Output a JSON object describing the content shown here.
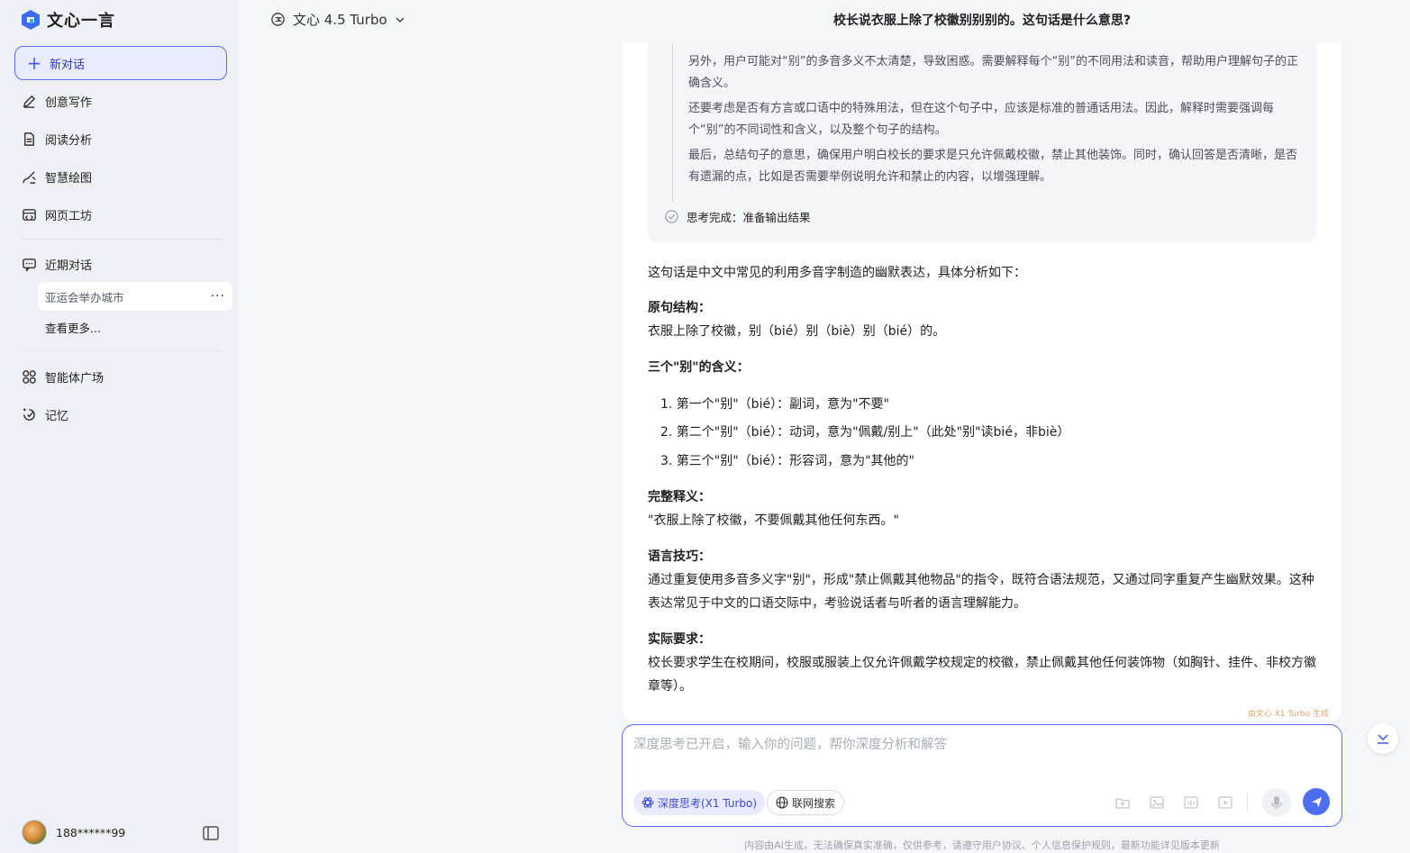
{
  "app": {
    "name": "文心一言",
    "accent": "#4e6ef2"
  },
  "sidebar": {
    "new_chat": "新对话",
    "items": [
      {
        "label": "创意写作",
        "icon": "pen-icon"
      },
      {
        "label": "阅读分析",
        "icon": "document-icon"
      },
      {
        "label": "智慧绘图",
        "icon": "brush-icon"
      },
      {
        "label": "网页工坊",
        "icon": "web-icon"
      }
    ],
    "recent_title": "近期对话",
    "recent": [
      {
        "label": "亚运会举办城市",
        "more": "···"
      }
    ],
    "more_link": "查看更多...",
    "bottom_items": [
      {
        "label": "智能体广场",
        "icon": "agents-icon"
      },
      {
        "label": "记忆",
        "icon": "memory-icon"
      }
    ],
    "user": {
      "name": "188******99"
    }
  },
  "header": {
    "model": "文心 4.5 Turbo",
    "title": "校长说衣服上除了校徽别别别的。这句话是什么意思?"
  },
  "thinking": {
    "paragraphs": [
      "另外，用户可能对“别”的多音多义不太清楚，导致困惑。需要解释每个“别”的不同用法和读音，帮助用户理解句子的正确含义。",
      "还要考虑是否有方言或口语中的特殊用法，但在这个句子中，应该是标准的普通话用法。因此，解释时需要强调每个“别”的不同词性和含义，以及整个句子的结构。",
      "最后，总结句子的意思，确保用户明白校长的要求是只允许佩戴校徽，禁止其他装饰。同时，确认回答是否清晰，是否有遗漏的点，比如是否需要举例说明允许和禁止的内容，以增强理解。"
    ],
    "done": "思考完成：准备输出结果"
  },
  "answer": {
    "intro": "这句话是中文中常见的利用多音字制造的幽默表达，具体分析如下：",
    "s1_title": "原句结构：",
    "s1_body": "衣服上除了校徽，别（bié）别（biè）别（bié）的。",
    "s2_title": "三个\"别\"的含义：",
    "s2_items": [
      "1. 第一个\"别\"（bié）：副词，意为\"不要\"",
      "2. 第二个\"别\"（bié）：动词，意为\"佩戴/别上\"（此处\"别\"读bié，非biè）",
      "3. 第三个\"别\"（bié）：形容词，意为\"其他的\""
    ],
    "s3_title": "完整释义：",
    "s3_body": "\"衣服上除了校徽，不要佩戴其他任何东西。\"",
    "s4_title": "语言技巧：",
    "s4_body": "通过重复使用多音多义字\"别\"，形成\"禁止佩戴其他物品\"的指令，既符合语法规范，又通过同字重复产生幽默效果。这种表达常见于中文的口语交际中，考验说话者与听者的语言理解能力。",
    "s5_title": "实际要求：",
    "s5_body": "校长要求学生在校期间，校服或服装上仅允许佩戴学校规定的校徽，禁止佩戴其他任何装饰物（如胸针、挂件、非校方徽章等）。",
    "watermark": "由文心 X1 Turbo 生成"
  },
  "input": {
    "placeholder": "深度思考已开启，输入你的问题，帮你深度分析和解答",
    "deep_think": "深度思考(X1 Turbo)",
    "web_search": "联网搜索"
  },
  "footer": "内容由AI生成，无法确保真实准确，仅供参考，请遵守用户协议、个人信息保护规则，最新功能详见版本更新"
}
